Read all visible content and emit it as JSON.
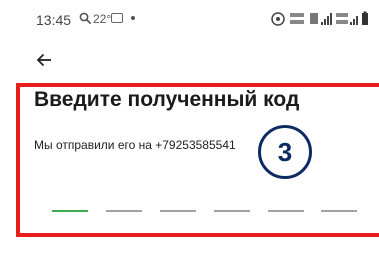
{
  "status_bar": {
    "time": "13:45",
    "temperature": "22°",
    "icons": [
      "search-icon",
      "image-icon",
      "dot-icon",
      "nfc-icon",
      "volte-lte1-icon",
      "4g-signal-icon",
      "volte-lte2-icon",
      "battery-icon"
    ]
  },
  "header": {
    "back_icon": "arrow-left-icon"
  },
  "content": {
    "title": "Введите полученный код",
    "sent_to_text": "Мы отправили его на +79253585541",
    "step_badge": "3",
    "code_slots": [
      {
        "active": true
      },
      {
        "active": false
      },
      {
        "active": false
      },
      {
        "active": false
      },
      {
        "active": false
      },
      {
        "active": false
      }
    ]
  },
  "colors": {
    "highlight_border": "#e81e1e",
    "active_slot": "#3daa55",
    "inactive_slot": "#9ea3a7",
    "badge": "#0c2b63"
  }
}
